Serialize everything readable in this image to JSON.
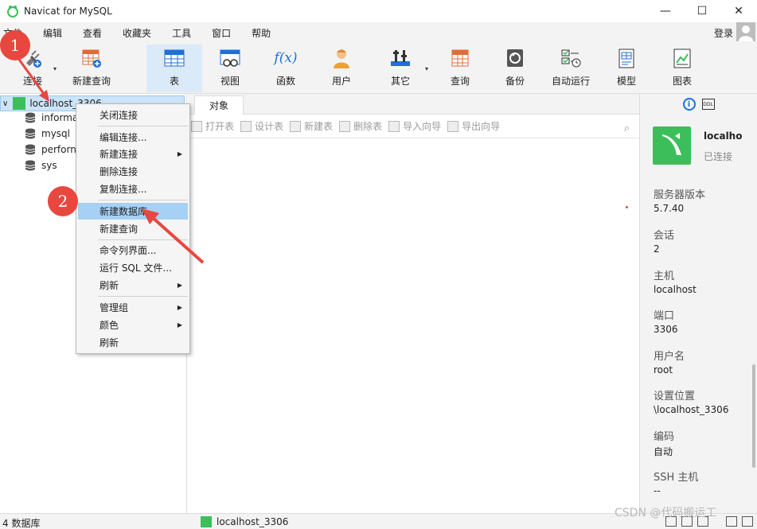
{
  "window": {
    "title": "Navicat for MySQL",
    "controls": {
      "minimize": "—",
      "maximize": "☐",
      "close": "✕"
    }
  },
  "menubar": {
    "items": [
      "文件",
      "编辑",
      "查看",
      "收藏夹",
      "工具",
      "窗口",
      "帮助"
    ],
    "login": "登录"
  },
  "toolbar": {
    "items": [
      {
        "label": "连接",
        "icon": "plug-connect-icon"
      },
      {
        "label": "新建查询",
        "icon": "new-query-icon"
      },
      {
        "label": "表",
        "icon": "table-icon"
      },
      {
        "label": "视图",
        "icon": "view-icon"
      },
      {
        "label": "函数",
        "icon": "function-icon",
        "glyph": "f(x)"
      },
      {
        "label": "用户",
        "icon": "user-icon"
      },
      {
        "label": "其它",
        "icon": "tools-icon"
      },
      {
        "label": "查询",
        "icon": "query-icon"
      },
      {
        "label": "备份",
        "icon": "backup-icon"
      },
      {
        "label": "自动运行",
        "icon": "schedule-icon"
      },
      {
        "label": "模型",
        "icon": "model-icon"
      },
      {
        "label": "图表",
        "icon": "chart-icon"
      }
    ],
    "active": "表"
  },
  "nav": {
    "connection": "localhost_3306",
    "databases": [
      "informa",
      "mysql",
      "perforn",
      "sys"
    ]
  },
  "center": {
    "tab": "对象",
    "actions": [
      "打开表",
      "设计表",
      "新建表",
      "删除表",
      "导入向导",
      "导出向导"
    ]
  },
  "context_menu": {
    "items": [
      "关闭连接",
      "编辑连接...",
      "新建连接",
      "删除连接",
      "复制连接...",
      "新建数据库...",
      "新建查询",
      "命令列界面...",
      "运行 SQL 文件...",
      "刷新",
      "管理组",
      "颜色",
      "刷新"
    ],
    "highlighted": "新建数据库..."
  },
  "info_panel": {
    "name": "localho",
    "status": "已连接",
    "props": [
      {
        "label": "服务器版本",
        "value": "5.7.40"
      },
      {
        "label": "会话",
        "value": "2"
      },
      {
        "label": "主机",
        "value": "localhost"
      },
      {
        "label": "端口",
        "value": "3306"
      },
      {
        "label": "用户名",
        "value": "root"
      },
      {
        "label": "设置位置",
        "value": "\\localhost_3306"
      },
      {
        "label": "编码",
        "value": "自动"
      },
      {
        "label": "SSH 主机",
        "value": "--"
      }
    ]
  },
  "statusbar": {
    "db_count": "4 数据库",
    "connection": "localhost_3306"
  },
  "annotations": {
    "step1": "1",
    "step2": "2"
  },
  "watermark": "CSDN @代码搬运工",
  "colors": {
    "accent_blue": "#1e6fd9",
    "navicat_green": "#3cbf5a",
    "highlight": "#a6d1f5",
    "annotation_red": "#e8473f"
  }
}
